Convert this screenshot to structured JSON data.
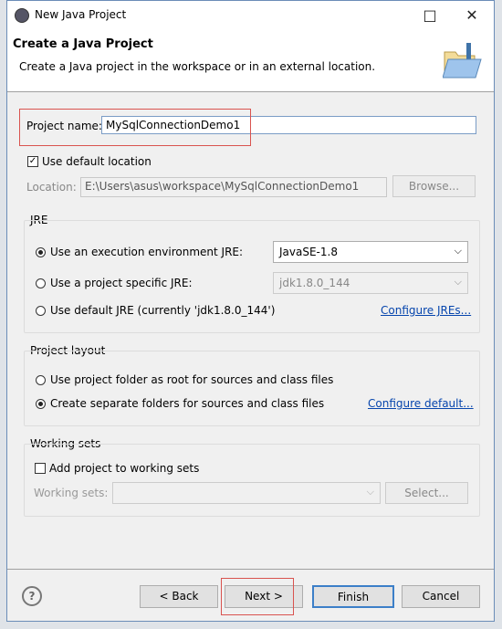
{
  "window": {
    "title": "New Java Project",
    "maximize_icon": "□",
    "close_icon": "✕"
  },
  "banner": {
    "title": "Create a Java Project",
    "description": "Create a Java project in the workspace or in an external location."
  },
  "project_name": {
    "label": "Project name:",
    "value": "MySqlConnectionDemo1"
  },
  "location": {
    "use_default_label": "Use default location",
    "use_default_checked": true,
    "label": "Location:",
    "value": "E:\\Users\\asus\\workspace\\MySqlConnectionDemo1",
    "browse": "Browse..."
  },
  "jre": {
    "title": "JRE",
    "option_env": "Use an execution environment JRE:",
    "env_value": "JavaSE-1.8",
    "option_specific": "Use a project specific JRE:",
    "specific_value": "jdk1.8.0_144",
    "option_default": "Use default JRE (currently 'jdk1.8.0_144')",
    "configure_link": "Configure JREs...",
    "selected": "env"
  },
  "layout": {
    "title": "Project layout",
    "option_root": "Use project folder as root for sources and class files",
    "option_separate": "Create separate folders for sources and class files",
    "configure_link": "Configure default...",
    "selected": "separate"
  },
  "working_sets": {
    "title": "Working sets",
    "add_label": "Add project to working sets",
    "add_checked": false,
    "label": "Working sets:",
    "value": "",
    "select": "Select..."
  },
  "buttons": {
    "help": "?",
    "back": "< Back",
    "next": "Next >",
    "finish": "Finish",
    "cancel": "Cancel"
  }
}
